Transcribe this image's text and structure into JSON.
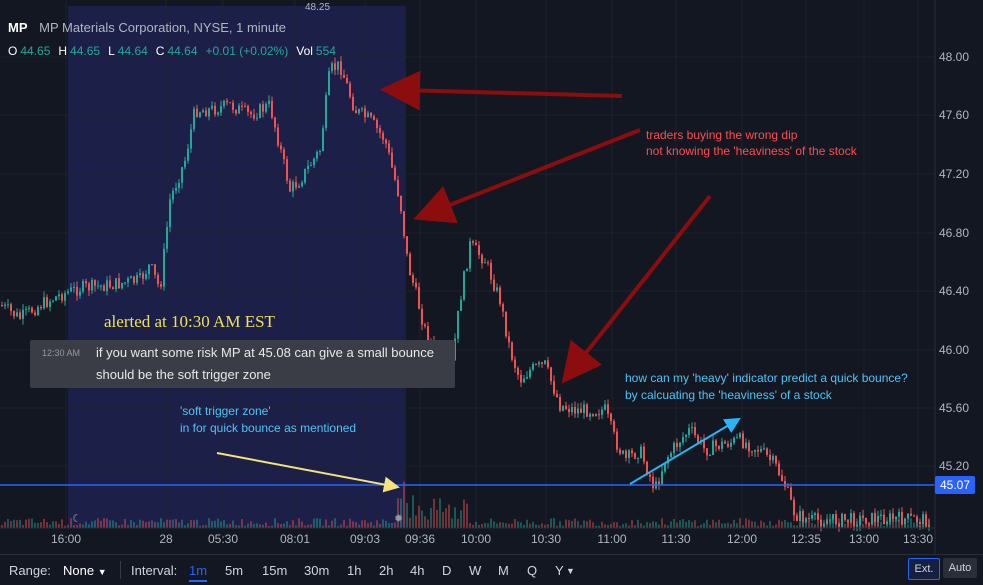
{
  "header": {
    "symbol": "MP",
    "description": "MP Materials Corporation, NYSE, 1 minute",
    "ohlc": [
      {
        "k": "O",
        "v": "44.65"
      },
      {
        "k": "H",
        "v": "44.65"
      },
      {
        "k": "L",
        "v": "44.64"
      },
      {
        "k": "C",
        "v": "44.64"
      },
      {
        "k": "",
        "v": "+0.01 (+0.02%)"
      },
      {
        "k": "Vol",
        "v": "554"
      }
    ]
  },
  "top_tag": "48.25",
  "y_axis": [
    "48.00",
    "47.60",
    "47.20",
    "46.80",
    "46.40",
    "46.00",
    "45.60",
    "45.20"
  ],
  "x_axis": [
    "16:00",
    "28",
    "05:30",
    "08:01",
    "09:03",
    "09:36",
    "10:00",
    "10:30",
    "11:00",
    "11:30",
    "12:00",
    "12:35",
    "13:00",
    "13:30"
  ],
  "price_line": {
    "value": "45.07",
    "color": "#2962ff"
  },
  "annotations": {
    "red_line1": "traders buying the wrong dip",
    "red_line2": "not knowing the 'heaviness' of the stock",
    "cyan_q1": "how can my 'heavy' indicator predict a quick bounce?",
    "cyan_q2": "by calcuating the 'heaviness' of a stock",
    "soft1": "'soft trigger zone'",
    "soft2": "in for quick bounce as mentioned",
    "alert_title": "alerted at 10:30 AM EST"
  },
  "message": {
    "time": "12:30 AM",
    "line1": "if you want some risk MP at 45.08 can give a small bounce",
    "line2": "should be the soft trigger zone"
  },
  "bottom_bar": {
    "range_label": "Range:",
    "range_value": "None",
    "interval_label": "Interval:",
    "intervals": [
      "1m",
      "5m",
      "15m",
      "30m",
      "1h",
      "2h",
      "4h",
      "D",
      "W",
      "M",
      "Q",
      "Y"
    ],
    "selected_interval": "1m",
    "ext": "Ext.",
    "auto": "Auto"
  },
  "colors": {
    "up": "#26a69a",
    "down": "#ef5350",
    "session": "#1b1f4a",
    "arrow_dark_red": "#8b0d0d",
    "arrow_yellow": "#f5e27a",
    "arrow_cyan": "#29b6f6"
  }
}
